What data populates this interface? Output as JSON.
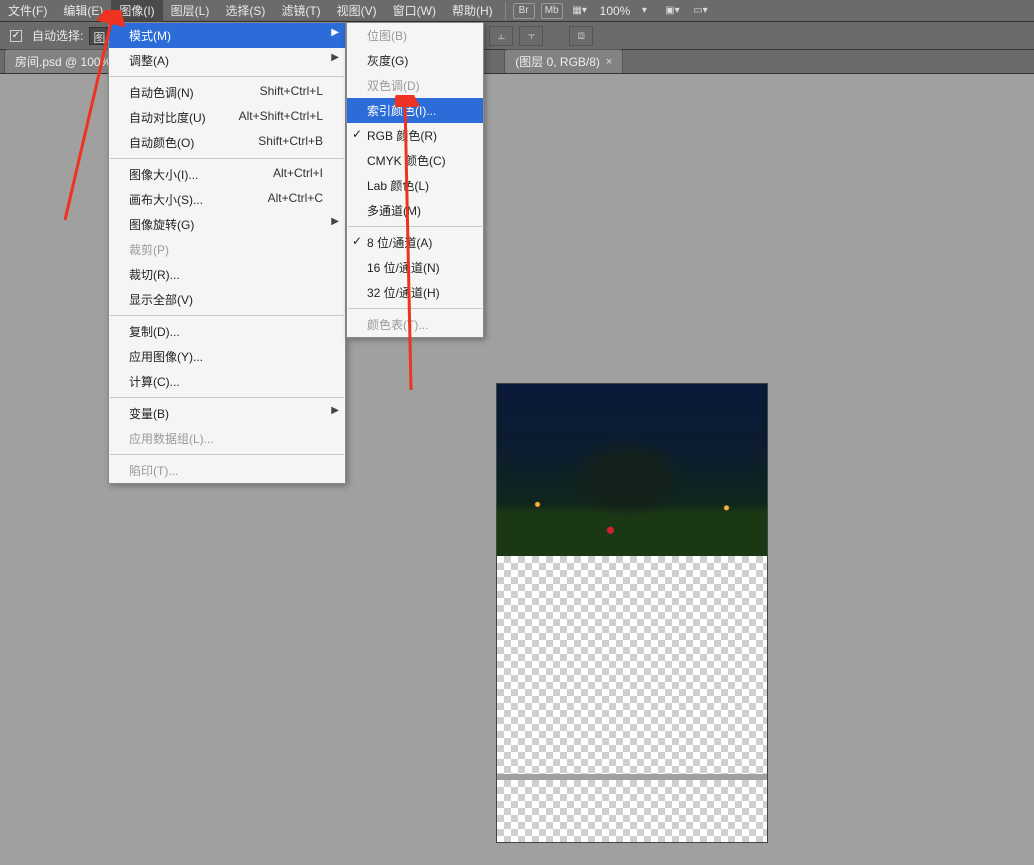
{
  "menubar": {
    "items": [
      "文件(F)",
      "编辑(E)",
      "图像(I)",
      "图层(L)",
      "选择(S)",
      "滤镜(T)",
      "视图(V)",
      "窗口(W)",
      "帮助(H)"
    ],
    "active_index": 2,
    "zoom": "100%",
    "icons": [
      "Br",
      "Mb"
    ]
  },
  "options_row": {
    "auto_select_label": "自动选择:",
    "group_field": "图"
  },
  "tabs": [
    {
      "label": "房间.psd @ 100%"
    },
    {
      "label": "(图层 0, RGB/8)"
    }
  ],
  "image_menu": [
    {
      "label": "模式(M)",
      "type": "submenu",
      "hl": true
    },
    {
      "label": "调整(A)",
      "type": "submenu"
    },
    {
      "type": "div"
    },
    {
      "label": "自动色调(N)",
      "short": "Shift+Ctrl+L"
    },
    {
      "label": "自动对比度(U)",
      "short": "Alt+Shift+Ctrl+L"
    },
    {
      "label": "自动颜色(O)",
      "short": "Shift+Ctrl+B"
    },
    {
      "type": "div"
    },
    {
      "label": "图像大小(I)...",
      "short": "Alt+Ctrl+I"
    },
    {
      "label": "画布大小(S)...",
      "short": "Alt+Ctrl+C"
    },
    {
      "label": "图像旋转(G)",
      "type": "submenu"
    },
    {
      "label": "裁剪(P)",
      "disabled": true
    },
    {
      "label": "裁切(R)..."
    },
    {
      "label": "显示全部(V)"
    },
    {
      "type": "div"
    },
    {
      "label": "复制(D)..."
    },
    {
      "label": "应用图像(Y)..."
    },
    {
      "label": "计算(C)..."
    },
    {
      "type": "div"
    },
    {
      "label": "变量(B)",
      "type": "submenu"
    },
    {
      "label": "应用数据组(L)...",
      "disabled": true
    },
    {
      "type": "div"
    },
    {
      "label": "陷印(T)...",
      "disabled": true
    }
  ],
  "mode_menu": [
    {
      "label": "位图(B)",
      "disabled": true
    },
    {
      "label": "灰度(G)"
    },
    {
      "label": "双色调(D)",
      "disabled": true
    },
    {
      "label": "索引颜色(I)...",
      "hl": true
    },
    {
      "label": "RGB 颜色(R)",
      "checked": true
    },
    {
      "label": "CMYK 颜色(C)"
    },
    {
      "label": "Lab 颜色(L)"
    },
    {
      "label": "多通道(M)"
    },
    {
      "type": "div"
    },
    {
      "label": "8 位/通道(A)",
      "checked": true
    },
    {
      "label": "16 位/通道(N)"
    },
    {
      "label": "32 位/通道(H)"
    },
    {
      "type": "div"
    },
    {
      "label": "颜色表(T)...",
      "disabled": true
    }
  ]
}
